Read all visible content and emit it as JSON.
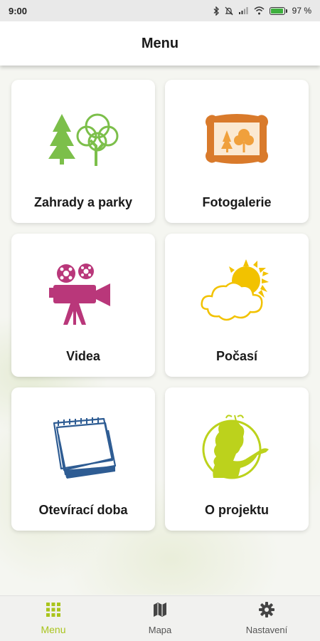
{
  "status_bar": {
    "time": "9:00",
    "battery_percent": "97 %",
    "battery_level": 0.97
  },
  "header": {
    "title": "Menu"
  },
  "tiles": [
    {
      "label": "Zahrady a parky",
      "icon": "trees-icon"
    },
    {
      "label": "Fotogalerie",
      "icon": "picture-frame-icon"
    },
    {
      "label": "Videa",
      "icon": "film-camera-icon"
    },
    {
      "label": "Počasí",
      "icon": "weather-sun-cloud-icon"
    },
    {
      "label": "Otevírací doba",
      "icon": "calendar-icon"
    },
    {
      "label": "O projektu",
      "icon": "person-silhouette-icon"
    }
  ],
  "bottom_nav": {
    "items": [
      {
        "label": "Menu",
        "icon": "grid-icon",
        "active": true
      },
      {
        "label": "Mapa",
        "icon": "map-icon",
        "active": false
      },
      {
        "label": "Nastavení",
        "icon": "gear-icon",
        "active": false
      }
    ]
  },
  "colors": {
    "accent": "#a9c41c",
    "tree_green": "#7cbf4a",
    "frame_orange": "#d97a2b",
    "camera_magenta": "#b9377a",
    "sun_yellow": "#f2c200",
    "calendar_blue": "#2e5c93",
    "person_lime": "#bcd21c"
  }
}
